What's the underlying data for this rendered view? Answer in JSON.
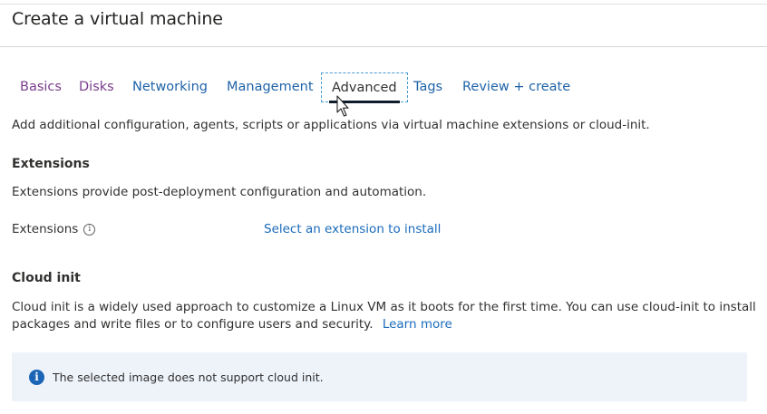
{
  "page": {
    "title": "Create a virtual machine"
  },
  "tabs": [
    {
      "label": "Basics",
      "state": "visited"
    },
    {
      "label": "Disks",
      "state": "visited"
    },
    {
      "label": "Networking",
      "state": "default"
    },
    {
      "label": "Management",
      "state": "default"
    },
    {
      "label": "Advanced",
      "state": "active"
    },
    {
      "label": "Tags",
      "state": "default"
    },
    {
      "label": "Review + create",
      "state": "default"
    }
  ],
  "advanced": {
    "description": "Add additional configuration, agents, scripts or applications via virtual machine extensions or cloud-init.",
    "extensions": {
      "heading": "Extensions",
      "description": "Extensions provide post-deployment configuration and automation.",
      "field_label": "Extensions",
      "info_icon": "info-circle-icon",
      "link_text": "Select an extension to install"
    },
    "cloud_init": {
      "heading": "Cloud init",
      "description_line1": "Cloud init is a widely used approach to customize a Linux VM as it boots for the first time. You can use cloud-init to install",
      "description_line2": "packages and write files or to configure users and security.",
      "learn_more": "Learn more",
      "banner_icon": "info-filled-icon",
      "banner_text": "The selected image does not support cloud init."
    }
  },
  "colors": {
    "link": "#1a6bbb",
    "visited_tab": "#7a3c8c",
    "banner_bg": "#eef3fa",
    "info_icon": "#1a65b6"
  }
}
